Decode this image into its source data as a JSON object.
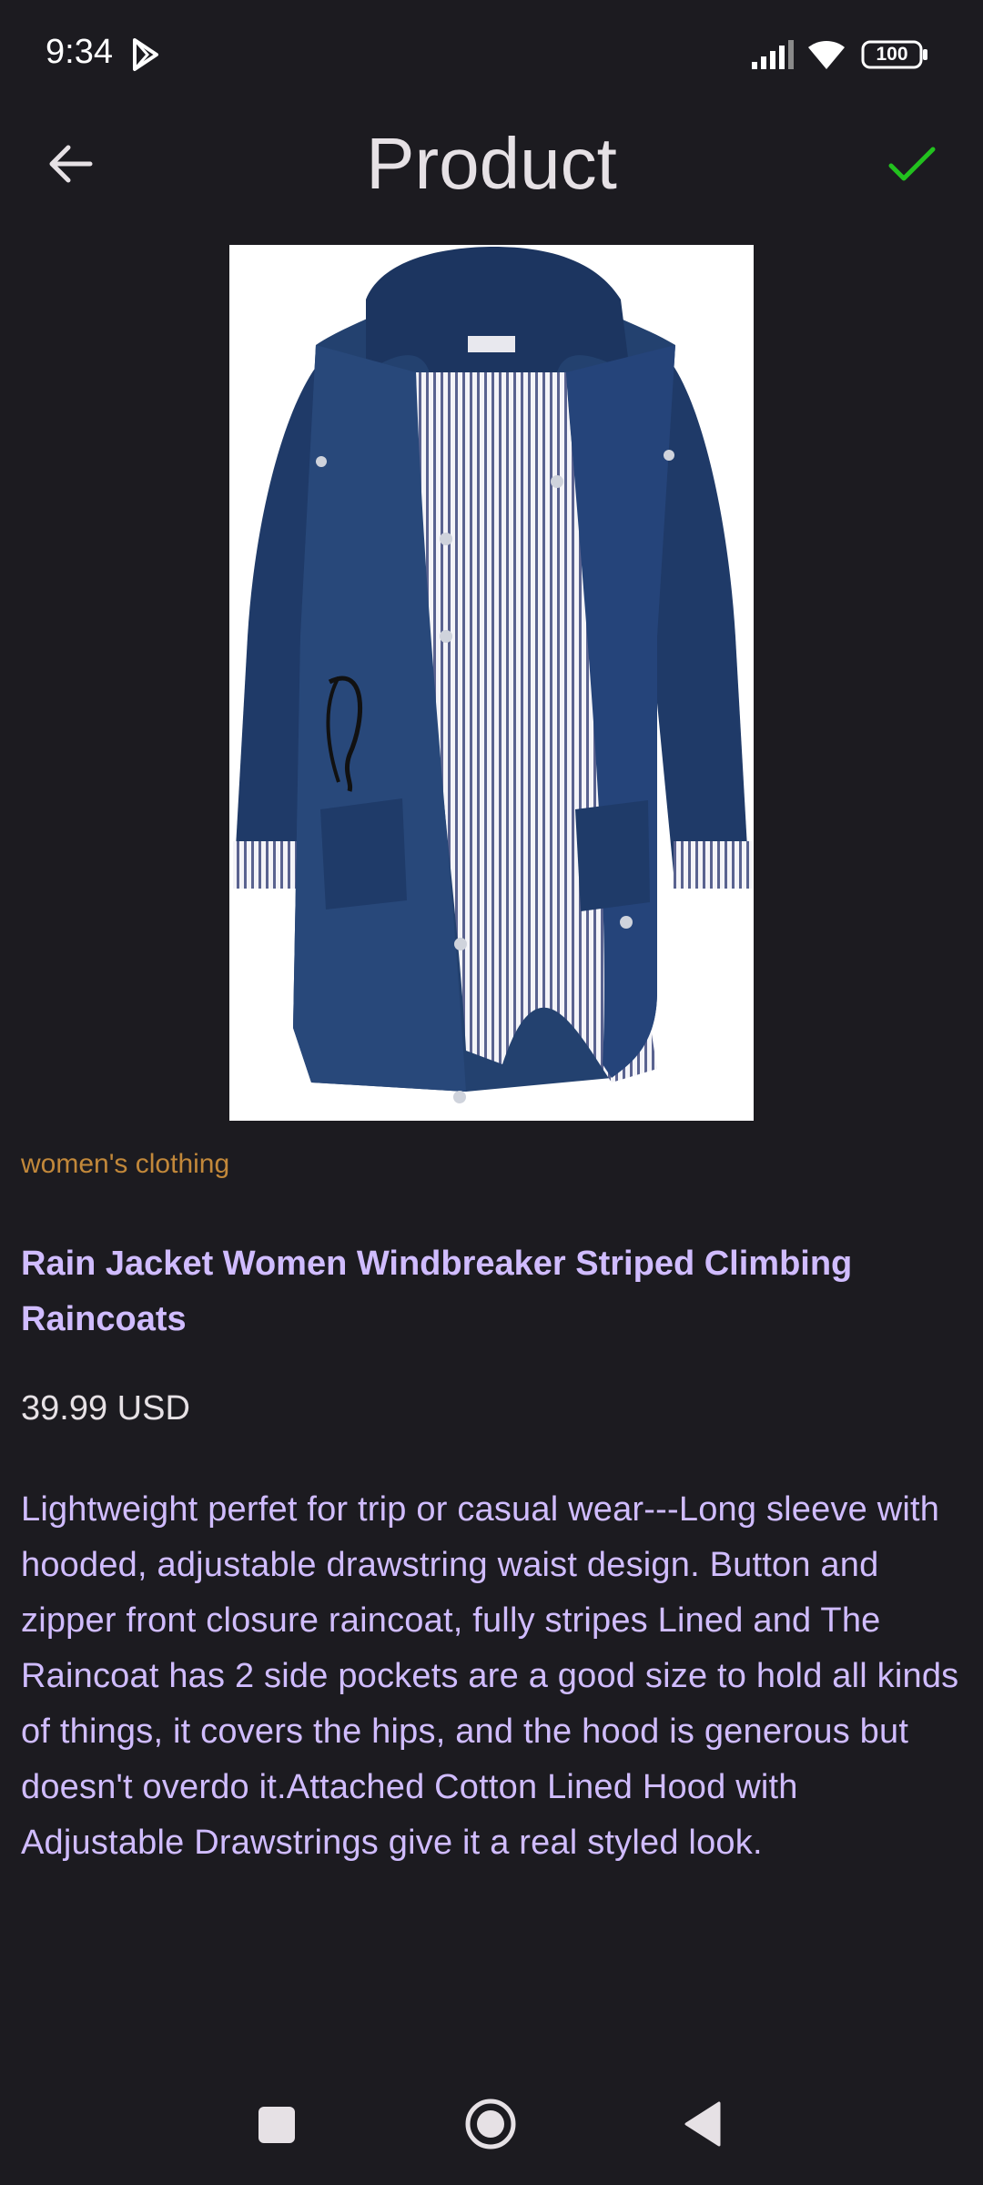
{
  "status_bar": {
    "time": "9:34",
    "battery": "100"
  },
  "header": {
    "title": "Product",
    "back_icon": "arrow-left-icon",
    "confirm_icon": "check-icon",
    "confirm_color": "#22c11e"
  },
  "product": {
    "image_alt": "navy blue rain jacket",
    "category": "women's clothing",
    "name": "Rain Jacket Women Windbreaker Striped Climbing Raincoats",
    "price": "39.99 USD",
    "description": "Lightweight perfet for trip or casual wear---Long sleeve with hooded, adjustable drawstring waist design. Button and zipper front closure raincoat, fully stripes Lined and The Raincoat has 2 side pockets are a good size to hold all kinds of things, it covers the hips, and the hood is generous but doesn't overdo it.Attached Cotton Lined Hood with Adjustable Drawstrings give it a real styled look."
  },
  "colors": {
    "background": "#1c1b20",
    "accent_text": "#d0bcff",
    "category_text": "#c2883a"
  }
}
